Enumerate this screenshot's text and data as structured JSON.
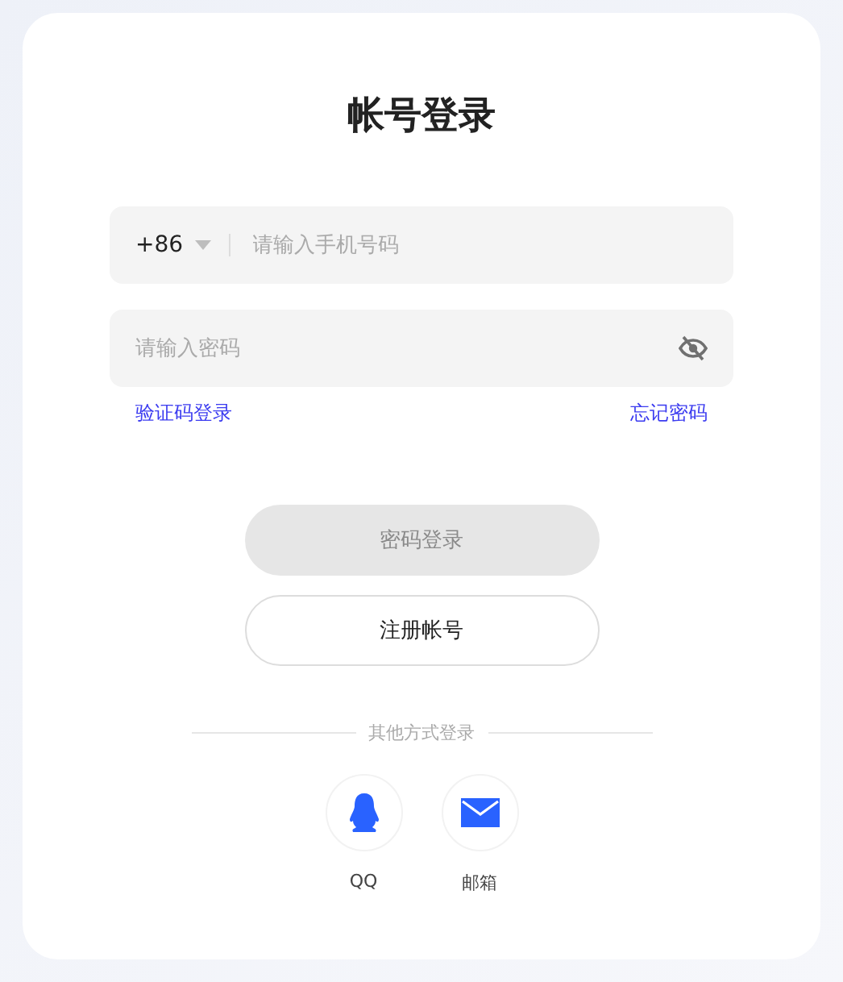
{
  "title": "帐号登录",
  "phone": {
    "code": "+86",
    "placeholder": "请输入手机号码"
  },
  "password": {
    "placeholder": "请输入密码"
  },
  "links": {
    "left": "验证码登录",
    "right": "忘记密码"
  },
  "login_button": {
    "label": "密码登录",
    "disabled": true
  },
  "register_button": {
    "label": "注册帐号"
  },
  "other_login": {
    "label": "其他方式登录",
    "options": [
      {
        "kind": "qq",
        "label": "QQ"
      },
      {
        "kind": "mail",
        "label": "邮箱"
      }
    ]
  }
}
